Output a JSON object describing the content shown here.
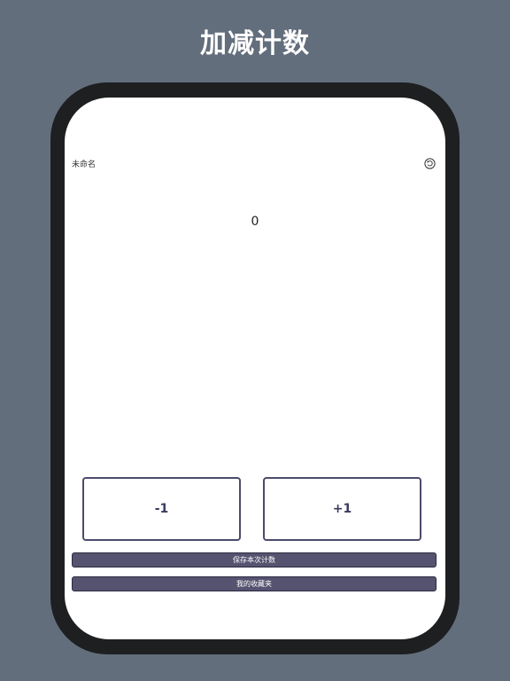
{
  "page": {
    "headline": "加减计数"
  },
  "counter": {
    "name": "未命名",
    "value": "0",
    "reset_icon": "reset-icon"
  },
  "controls": {
    "decrement_label": "-1",
    "increment_label": "+1",
    "save_label": "保存本次计数",
    "favorites_label": "我的收藏夹"
  },
  "colors": {
    "background": "#636e7c",
    "device_frame": "#1d1f21",
    "screen": "#ffffff",
    "button_border": "#4c4b6d",
    "bar_button": "#555370"
  }
}
